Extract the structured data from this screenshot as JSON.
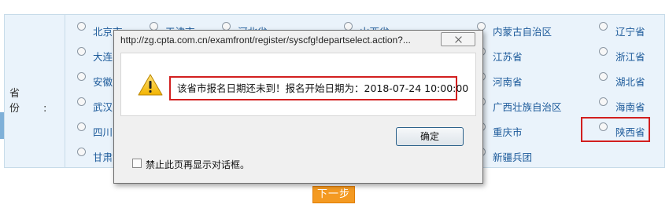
{
  "province_section": {
    "label": "省 份:",
    "provinces": [
      "北京市",
      "天津市",
      "河北省",
      "山西省",
      "内蒙古自治区",
      "辽宁省",
      "大连",
      "江苏省",
      "浙江省",
      "安徽",
      "河南省",
      "湖北省",
      "武汉",
      "广西壮族自治区",
      "海南省",
      "四川",
      "重庆市",
      "陕西省",
      "甘肃",
      "新疆兵团"
    ],
    "highlighted_province": "陕西省"
  },
  "next_button": {
    "label": "下一步"
  },
  "dialog": {
    "title": "http://zg.cpta.com.cn/examfront/register/syscfg!departselect.action?...",
    "message": "该省市报名日期还未到！报名开始日期为：2018-07-24 10:00:00",
    "ok_label": "确定",
    "suppress_label": "禁止此页再显示对话框。",
    "icon": "warning-icon"
  },
  "colors": {
    "link_blue": "#1c5a9a",
    "highlight_red": "#d21f1f",
    "button_orange": "#f49a22",
    "table_bg": "#eaf3fb"
  }
}
